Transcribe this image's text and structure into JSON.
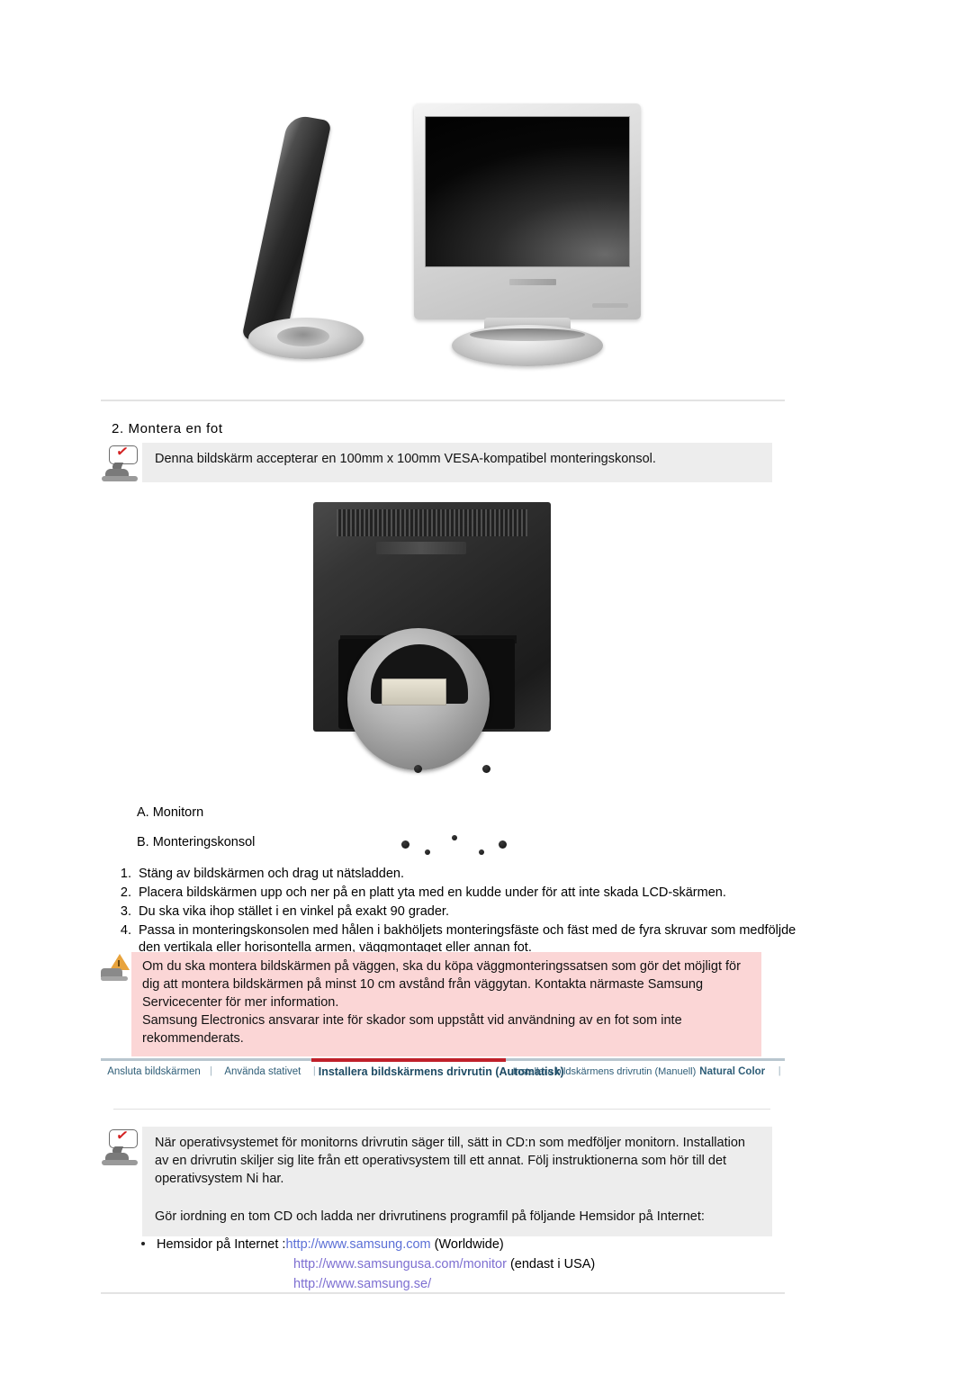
{
  "document": {
    "language": "sv",
    "heading": "2. Montera en fot"
  },
  "hero": {
    "caption_left": "monitor-side-view",
    "caption_right": "monitor-front-view"
  },
  "note_vesa": {
    "icon": "note-icon",
    "text": "Denna bildskärm accepterar en 100mm x 100mm VESA-kompatibel monteringskonsol."
  },
  "back_photo": {
    "icon": "monitor-back-photo"
  },
  "labels": {
    "a": "A. Monitorn",
    "b": "B. Monteringskonsol"
  },
  "steps": [
    {
      "num": "1.",
      "text": "Stäng av bildskärmen och drag ut nätsladden."
    },
    {
      "num": "2.",
      "text": "Placera bildskärmen upp och ner på en platt yta med en kudde under för att inte skada LCD-skärmen."
    },
    {
      "num": "3.",
      "text": "Du ska vika ihop stället i en vinkel på exakt 90 grader."
    },
    {
      "num": "4.",
      "text": "Passa in monteringskonsolen med hålen i bakhöljets monteringsfäste och fäst med de fyra skruvar som medföljde den vertikala eller horisontella armen, väggmontaget eller annan fot."
    }
  ],
  "warning": {
    "icon": "warning-triangle-icon",
    "paragraph1": "Om du ska montera bildskärmen på väggen, ska du köpa väggmonteringssatsen som gör det möjligt för dig att montera bildskärmen på minst 10 cm avstånd från väggytan. Kontakta närmaste Samsung Servicecenter för mer information.",
    "paragraph2": "Samsung Electronics ansvarar inte för skador som uppstått vid användning av en fot som inte rekommenderats."
  },
  "tabnav": {
    "separator": "|",
    "active_accent": "#c0202a",
    "link_color": "#2e5d77",
    "tabs": [
      {
        "label": "Ansluta bildskärmen",
        "active": false
      },
      {
        "label": "Använda stativet",
        "active": false
      },
      {
        "label": "Installera bildskärmens drivrutin (Automatisk)",
        "active": true
      },
      {
        "label": "Installera bildskärmens drivrutin (Manuell)",
        "active": false
      },
      {
        "label": "Natural Color",
        "active": false
      }
    ]
  },
  "note_driver": {
    "icon": "note-icon",
    "paragraph1": "När operativsystemet för monitorns drivrutin säger till, sätt in CD:n som medföljer monitorn. Installation av en drivrutin skiljer sig lite från ett operativsystem till ett annat. Följ instruktionerna som hör till det operativsystem Ni har.",
    "paragraph2": "Gör iordning en tom CD och ladda ner drivrutinens programfil på följande Hemsidor på Internet:"
  },
  "links": {
    "lead": "Hemsidor på Internet :",
    "url_worldwide": "http://www.samsung.com",
    "suffix_worldwide": " (Worldwide)",
    "url_usa": "http://www.samsungusa.com/monitor",
    "suffix_usa": " (endast i USA)",
    "url_se": "http://www.samsung.se/"
  }
}
